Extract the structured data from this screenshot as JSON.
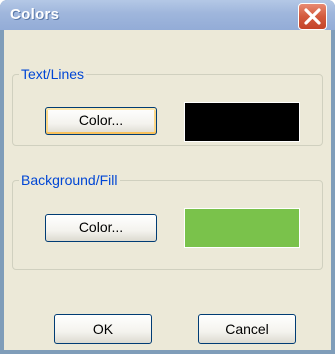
{
  "window": {
    "title": "Colors"
  },
  "text_lines": {
    "legend": "Text/Lines",
    "color_button": "Color...",
    "swatch_color": "#000000"
  },
  "background_fill": {
    "legend": "Background/Fill",
    "color_button": "Color...",
    "swatch_color": "#7ac24b"
  },
  "footer": {
    "ok_label": "OK",
    "cancel_label": "Cancel"
  },
  "icons": {
    "close": "close-icon"
  },
  "theme": {
    "legend_text": "#0046d5",
    "client_bg": "#ece9d8",
    "titlebar": "#9fb6dc",
    "close_button": "#d35a3e"
  }
}
